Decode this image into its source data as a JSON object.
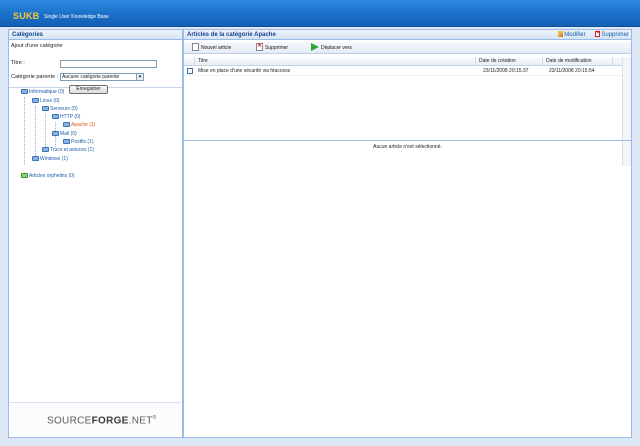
{
  "header": {
    "logo": "SUKB",
    "tagline": "Single User Knowledge Base"
  },
  "left_panel": {
    "title": "Catégories",
    "form": {
      "section_label": "Ajout d'une catégorie",
      "title_label": "Titre :",
      "title_value": "",
      "parent_label": "Catégorie parente :",
      "parent_selected": "Aucune catégorie parente",
      "save_label": "Enregistrer"
    },
    "tree": [
      {
        "label": "Informatique (0)",
        "icon": "folder-blue"
      },
      {
        "label": "Linux (0)",
        "icon": "folder-blue"
      },
      {
        "label": "Serveurs (0)",
        "icon": "folder-blue"
      },
      {
        "label": "HTTP (0)",
        "icon": "folder-blue"
      },
      {
        "label": "Apache (1)",
        "icon": "folder-blue",
        "selected": true
      },
      {
        "label": "Mail (0)",
        "icon": "folder-blue"
      },
      {
        "label": "Postfix (1)",
        "icon": "folder-blue"
      },
      {
        "label": "Trucs et astuces (1)",
        "icon": "folder-blue"
      },
      {
        "label": "Windows (1)",
        "icon": "folder-blue"
      },
      {
        "label": "Articles orphelins (0)",
        "icon": "folder-green"
      }
    ],
    "footer_logo_a": "SOURCE",
    "footer_logo_b": "FORGE",
    "footer_logo_c": ".NET",
    "footer_logo_mark": "®"
  },
  "right_panel": {
    "title": "Articles de la catégorie Apache",
    "actions": {
      "edit": "Modifier",
      "delete": "Supprimer"
    },
    "toolbar": {
      "new_article": "Nouvel article",
      "delete": "Supprimer",
      "move": "Déplacer vers"
    },
    "grid": {
      "columns": [
        "Titre",
        "Date de création",
        "Date de modification"
      ],
      "rows": [
        {
          "title": "Mise en place d'une sécurité via htaccess",
          "created": "23/11/2008 20:15:37",
          "modified": "23/11/2008 20:15:54"
        }
      ]
    },
    "detail_message": "Aucun article n'est sélectionné."
  },
  "colors": {
    "header_blue": "#1a6fc8",
    "logo_yellow": "#f5c636",
    "panel_border": "#99bbe8",
    "selected_tree": "#d9531a"
  }
}
